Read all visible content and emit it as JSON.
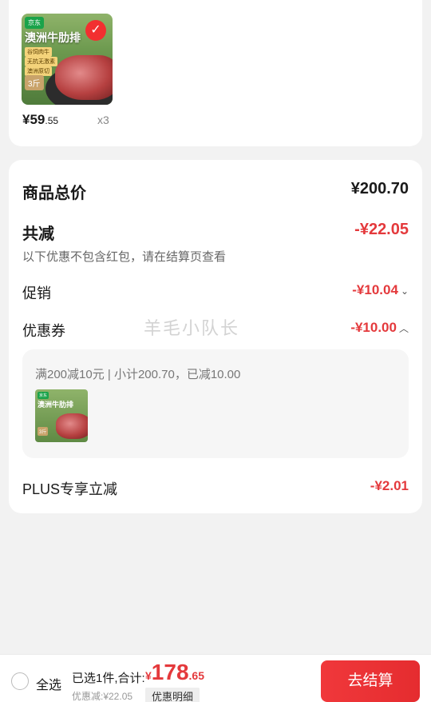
{
  "product": {
    "image_brand": "京东",
    "image_title": "澳洲牛肋排",
    "image_tags": [
      "谷饲肉牛",
      "无抗无激素",
      "澳洲原切"
    ],
    "image_weight": "3斤",
    "price_int": "¥59",
    "price_dec": ".55",
    "quantity": "x3",
    "selected_icon": "check-icon"
  },
  "summary": {
    "total_label": "商品总价",
    "total_value": "¥200.70",
    "discount_label": "共减",
    "discount_value": "-¥22.05",
    "discount_note": "以下优惠不包含红包，请在结算页查看",
    "promo_label": "促销",
    "promo_value": "-¥10.04",
    "coupon_label": "优惠券",
    "coupon_value": "-¥10.00",
    "coupon_detail": "满200减10元 | 小计200.70，已减10.00",
    "plus_label": "PLUS专享立减",
    "plus_value": "-¥2.01"
  },
  "watermark": "羊毛小队长",
  "bottom": {
    "select_all": "全选",
    "selected_count": "已选1件,合计:",
    "total_yen": "¥",
    "total_int": "178",
    "total_dec": ".65",
    "saved": "优惠减:¥22.05",
    "detail_button": "优惠明细",
    "checkout_button": "去结算"
  },
  "colors": {
    "accent": "#e4393c",
    "check_badge": "#f23030"
  }
}
